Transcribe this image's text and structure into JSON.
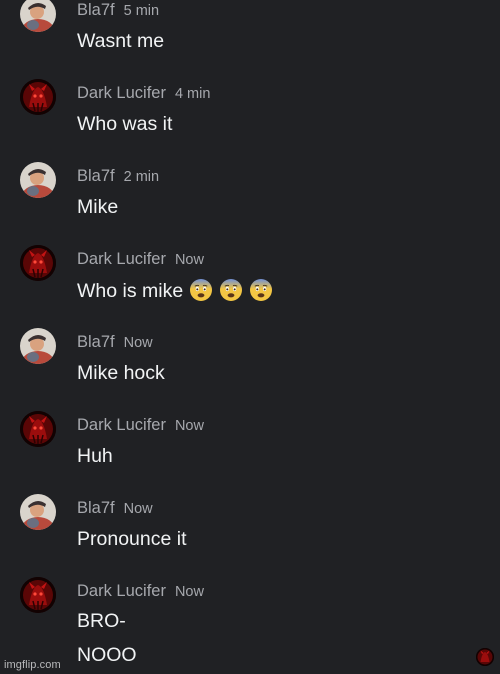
{
  "conversation": {
    "messages": [
      {
        "author": "Bla7f",
        "time": "5 min",
        "text": "Wasnt me"
      },
      {
        "author": "Dark Lucifer",
        "time": "4 min",
        "text": "Who was it"
      },
      {
        "author": "Bla7f",
        "time": "2 min",
        "text": "Mike"
      },
      {
        "author": "Dark Lucifer",
        "time": "Now",
        "text": "Who is mike",
        "emojis": [
          "fearful-face",
          "fearful-face",
          "fearful-face"
        ]
      },
      {
        "author": "Bla7f",
        "time": "Now",
        "text": "Mike hock"
      },
      {
        "author": "Dark Lucifer",
        "time": "Now",
        "text": "Huh"
      },
      {
        "author": "Bla7f",
        "time": "Now",
        "text": "Pronounce it"
      },
      {
        "author": "Dark Lucifer",
        "time": "Now",
        "text": "BRO-",
        "text2": "NOOO"
      }
    ]
  },
  "footer": {
    "watermark": "imgflip.com"
  },
  "colors": {
    "background": "#202124",
    "meta_text": "#a6a8ad",
    "message_text": "#f1f3f4"
  }
}
